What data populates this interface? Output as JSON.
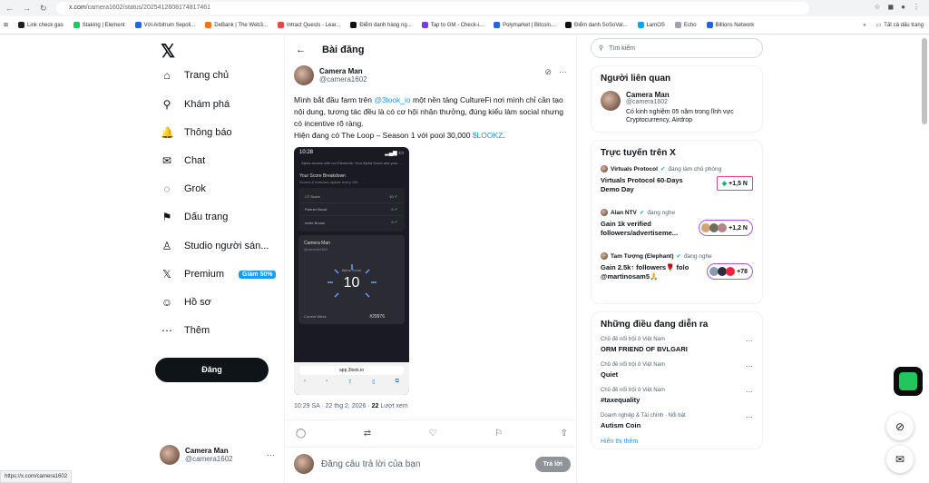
{
  "browser": {
    "url_host": "x.com",
    "url_path": "/camera1602/status/2025412608174817461",
    "status_tip": "https://x.com/camera1602"
  },
  "bookmarks": [
    {
      "label": "Link check gas",
      "color": "#222"
    },
    {
      "label": "Staking | Element",
      "color": "#22c55e"
    },
    {
      "label": "Với Arbitrum Sepoli...",
      "color": "#2563eb"
    },
    {
      "label": "DeBank | The Web3...",
      "color": "#f97316"
    },
    {
      "label": "Intract Quests - Lear...",
      "color": "#ef4444"
    },
    {
      "label": "Điểm danh hàng ng...",
      "color": "#111"
    },
    {
      "label": "Tap to GM - Check-i...",
      "color": "#7c3aed"
    },
    {
      "label": "Polymarket | Bitcoin...",
      "color": "#2563eb"
    },
    {
      "label": "Điểm danh SoSoVal...",
      "color": "#111"
    },
    {
      "label": "LamOS",
      "color": "#0ea5e9"
    },
    {
      "label": "Echo",
      "color": "#9ca3af"
    },
    {
      "label": "Billions Network",
      "color": "#2563eb"
    }
  ],
  "bookmarks_all": "Tất cả dấu trang",
  "nav": {
    "items": [
      {
        "label": "Trang chủ",
        "icon": "⌂",
        "name": "home-icon"
      },
      {
        "label": "Khám phá",
        "icon": "⚲",
        "name": "search-icon"
      },
      {
        "label": "Thông báo",
        "icon": "🔔",
        "name": "bell-icon"
      },
      {
        "label": "Chat",
        "icon": "✉",
        "name": "mail-icon"
      },
      {
        "label": "Grok",
        "icon": "◌",
        "name": "grok-icon"
      },
      {
        "label": "Dấu trang",
        "icon": "⚑",
        "name": "bookmark-icon"
      },
      {
        "label": "Studio người sán...",
        "icon": "♙",
        "name": "studio-icon"
      },
      {
        "label": "Premium",
        "icon": "𝕏",
        "name": "premium-icon"
      },
      {
        "label": "Hồ sơ",
        "icon": "☺",
        "name": "profile-icon"
      },
      {
        "label": "Thêm",
        "icon": "⋯",
        "name": "more-icon"
      }
    ],
    "premium_badge": "Giảm 50%",
    "post_button": "Đăng",
    "account": {
      "name": "Camera Man",
      "handle": "@camera1602"
    }
  },
  "main": {
    "header": "Bài đăng",
    "author": {
      "name": "Camera Man",
      "handle": "@camera1602"
    },
    "text": {
      "p1_a": "Mình bắt đầu farm trên ",
      "p1_link": "@3look_io",
      "p1_b": " một nền tảng CultureFi nơi mình chỉ cần tạo nội dung, tương tác đều là có cơ hội nhận thưởng, đúng kiểu làm social nhưng có incentive rõ ràng.",
      "p2_a": "Hiện đang có The Loop – Season 1 với pool 30,000 ",
      "p2_link": "$LOOKZ",
      "p2_b": "."
    },
    "phone": {
      "time": "10:28",
      "intro": "Alpha access with our Elements. Your Alpha Score and your ...",
      "breakdown_title": "Your Score Breakdown",
      "breakdown_sub": "Scores & bonuses update every 24h",
      "rows": [
        {
          "label": "CT Score",
          "value": "10"
        },
        {
          "label": "Partner Boost",
          "value": "0"
        },
        {
          "label": "Invite Bonus",
          "value": "0"
        }
      ],
      "card_name": "Camera Man",
      "card_handle": "@camera1602",
      "score_label": "Alpha Score",
      "score": "10",
      "rank_label": "Current Week",
      "rank": "#29976",
      "url": "app.3look.io"
    },
    "meta_time": "10:29 SA · 22 thg 2, 2026 · ",
    "meta_views_num": "22",
    "meta_views_label": " Lượt xem",
    "reply_placeholder": "Đăng câu trả lời của bạn",
    "reply_button": "Trả lời"
  },
  "right": {
    "search_placeholder": "Tìm kiếm",
    "related_title": "Người liên quan",
    "related": {
      "name": "Camera Man",
      "handle": "@camera1602",
      "bio": "Có kinh nghiệm 05 năm trong lĩnh vực Cryptocurrency, Airdrop"
    },
    "live_title": "Trực tuyến trên X",
    "live": [
      {
        "host": "Virtuals Protocol",
        "status": "đang làm chủ phòng",
        "title": "Virtuals Protocol 60-Days Demo Day",
        "count": "+1,5 N"
      },
      {
        "host": "Alan NTV",
        "status": "đang nghe",
        "title": "Gain 1k verified followers/advertiseme...",
        "count": "+1,2 N"
      },
      {
        "host": "Tam Tượng (Elephant)",
        "status": "đang nghe",
        "title": "Gain 2.5k↑ followers🌹 folo @martinosam5🙏",
        "count": "+78"
      }
    ],
    "trends_title": "Những điều đang diễn ra",
    "trends": [
      {
        "context": "Chủ đề nổi trội ở Việt Nam",
        "title": "ORM FRIEND OF BVLGARI"
      },
      {
        "context": "Chủ đề nổi trội ở Việt Nam",
        "title": "Quiet"
      },
      {
        "context": "Chủ đề nổi trội ở Việt Nam",
        "title": "#taxequality"
      },
      {
        "context": "Doanh nghiệp & Tài chính · Nổi bật",
        "title": "Autism Coin"
      }
    ],
    "show_more": "Hiển thị thêm"
  }
}
